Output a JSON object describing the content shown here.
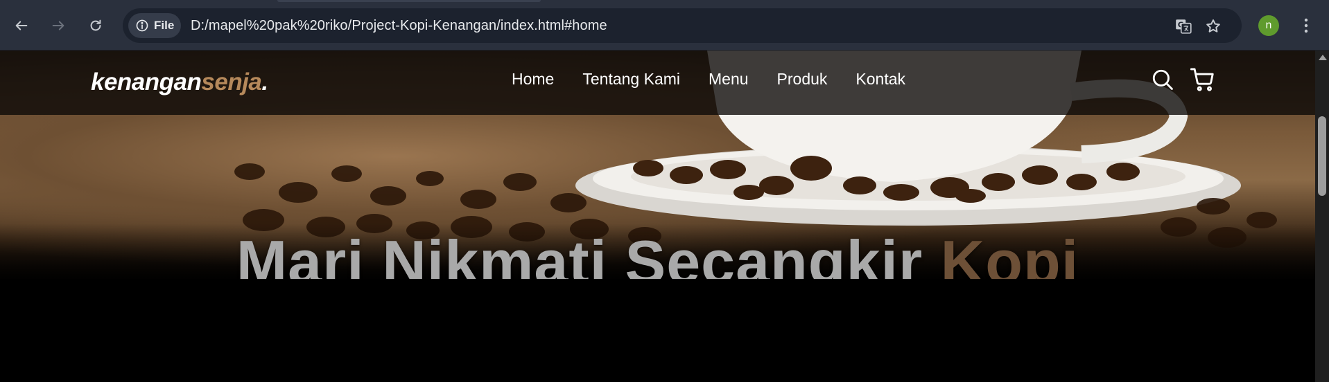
{
  "browser": {
    "nav": {
      "back_icon": "arrow-left-icon",
      "forward_icon": "arrow-right-icon",
      "reload_icon": "reload-icon"
    },
    "omnibox": {
      "site_info_label": "File",
      "url": "D:/mapel%20pak%20riko/Project-Kopi-Kenangan/index.html#home",
      "translate_icon": "translate-icon",
      "bookmark_icon": "star-icon"
    },
    "profile_initial": "n",
    "menu_icon": "more-vertical-icon"
  },
  "page": {
    "brand": {
      "main": "kenangan",
      "accent": "senja",
      "suffix": "."
    },
    "nav_links": [
      "Home",
      "Tentang Kami",
      "Menu",
      "Produk",
      "Kontak"
    ],
    "actions": {
      "search_icon": "search-icon",
      "cart_icon": "shopping-cart-icon"
    },
    "hero": {
      "title_main": "Mari Nikmati Secangkir ",
      "title_accent": "Kopi"
    }
  },
  "colors": {
    "accent": "#b6895b",
    "chrome_bg": "#2a303d",
    "omnibox_bg": "#1c222e",
    "navbar_bg": "rgba(10,8,6,0.78)",
    "avatar_bg": "#5f9b2d"
  }
}
